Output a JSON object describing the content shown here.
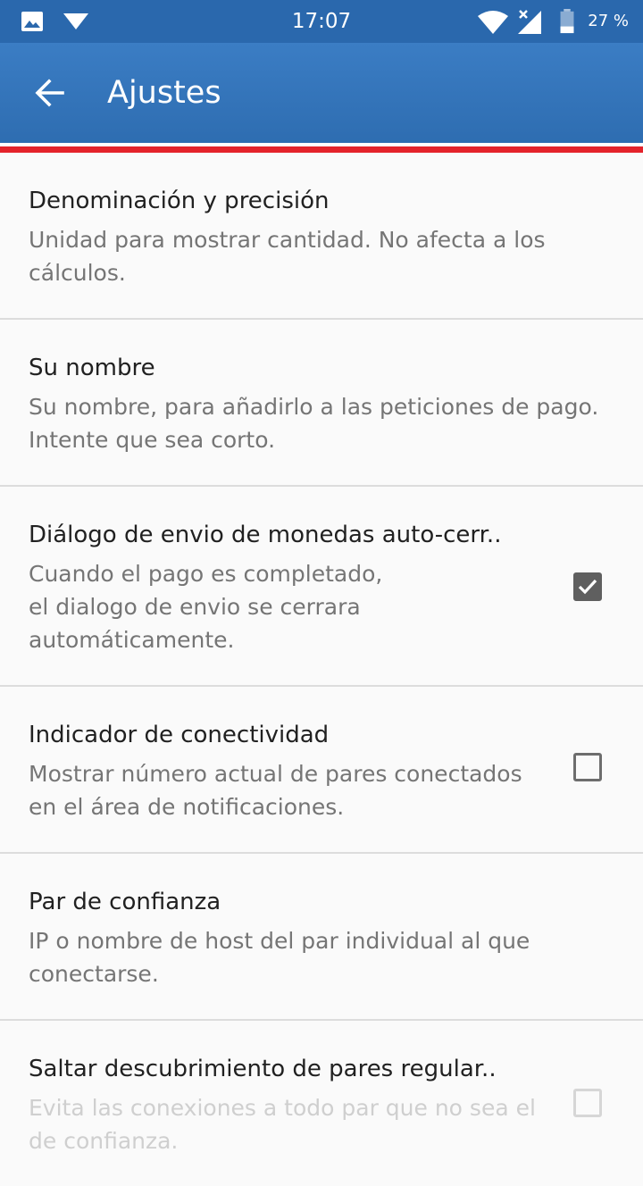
{
  "status_bar": {
    "time": "17:07",
    "battery": "27 %",
    "icons": [
      "image-icon",
      "download-icon",
      "wifi-icon",
      "cell-signal-icon",
      "battery-icon"
    ]
  },
  "app_bar": {
    "title": "Ajustes",
    "back_icon": "arrow-back-icon"
  },
  "colors": {
    "status_bar": "#2a68ad",
    "app_bar": "#3477bd",
    "accent_red": "#e4232b",
    "background": "#fafafa"
  },
  "settings": [
    {
      "title": "Denominación y precisión",
      "summary": "Unidad para mostrar cantidad. No afecta a los cálculos."
    },
    {
      "title": "Su nombre",
      "summary": "Su nombre, para añadirlo a las peticiones de pago. Intente que sea corto."
    },
    {
      "title": "Diálogo de envio de monedas auto-cerr..",
      "summary": "Cuando el pago es completado,\nel dialogo de envio se cerrara automáticamente.",
      "checked": true
    },
    {
      "title": "Indicador de conectividad",
      "summary": "Mostrar número actual de pares conectados en el área de notificaciones.",
      "checked": false
    },
    {
      "title": "Par de confianza",
      "summary": "IP o nombre de host del par individual al que conectarse."
    },
    {
      "title": "Saltar descubrimiento de pares regular..",
      "summary": "Evita las conexiones a todo par que no sea el de confianza.",
      "checked": false,
      "disabled": true
    }
  ]
}
